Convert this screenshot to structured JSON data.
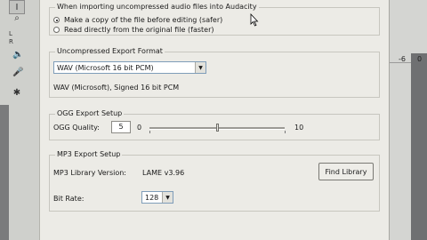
{
  "toolbar": {
    "tools": [
      "selection-tool-icon",
      "zoom-tool-icon"
    ],
    "ruler_l": "L",
    "ruler_r": "R"
  },
  "right_panel": {
    "values": [
      "-6",
      "0"
    ]
  },
  "import": {
    "title": "When importing uncompressed audio files into Audacity",
    "option_copy": "Make a copy of the file before editing (safer)",
    "option_read": "Read directly from the original file (faster)"
  },
  "uncompressed": {
    "title": "Uncompressed Export Format",
    "selected": "WAV (Microsoft 16 bit PCM)",
    "description": "WAV (Microsoft), Signed 16 bit PCM"
  },
  "ogg": {
    "title": "OGG Export Setup",
    "quality_label": "OGG Quality:",
    "quality_value": "5",
    "min_label": "0",
    "max_label": "10",
    "level": 0.5
  },
  "mp3": {
    "title": "MP3 Export Setup",
    "library_label": "MP3 Library Version:",
    "library_version": "LAME v3.96",
    "find_button": "Find Library",
    "bitrate_label": "Bit Rate:",
    "bitrate_value": "128"
  }
}
